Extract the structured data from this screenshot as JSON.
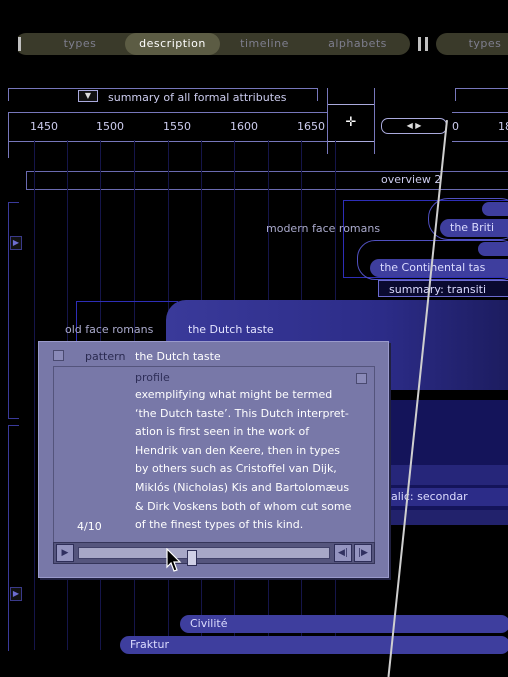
{
  "nav": {
    "tabs": [
      "types",
      "description",
      "timeline",
      "alphabets"
    ],
    "active_tab": "description",
    "second_group_tab": "types"
  },
  "summary": {
    "dropdown_label": "summary of all formal attributes"
  },
  "ruler": {
    "years": [
      "1450",
      "1500",
      "1550",
      "1600",
      "1650",
      "0",
      "18"
    ]
  },
  "overview": {
    "label": "overview 2"
  },
  "timeline": {
    "labels": {
      "modern_face": "modern face romans",
      "old_face": "old face romans"
    },
    "bars": {
      "british": "the Briti",
      "continental": "the Continental tas",
      "summary_transit": "summary: transiti",
      "dutch": "the Dutch taste",
      "italic_secondary": "alic: secondar",
      "civilite": "Civilité",
      "fraktur": "Fraktur"
    }
  },
  "popup": {
    "pattern_label": "pattern",
    "pattern_value": "the Dutch taste",
    "profile_label": "profile",
    "body": [
      "exemplifying what might be termed",
      "‘the Dutch taste’. This Dutch interpret-",
      "ation is first seen in the work of",
      "Hendrik van den Keere, then in types",
      "by others such as Cristoffel van Dijk,",
      "Miklós (Nicholas) Kis and Bartolomæus",
      "& Dirk Voskens both of whom cut some",
      "of the finest types of this kind."
    ],
    "page": "4/10",
    "scroll_fraction": 0.45
  },
  "colors": {
    "background": "#000000",
    "bar": "#3e3e9e",
    "popup": "#7878a8",
    "nav": "#3a3a2a"
  }
}
